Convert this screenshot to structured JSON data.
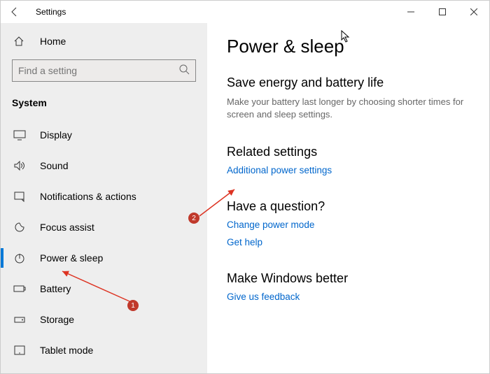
{
  "window": {
    "title": "Settings"
  },
  "sidebar": {
    "home": "Home",
    "search": {
      "placeholder": "Find a setting"
    },
    "group": "System",
    "items": [
      {
        "label": "Display"
      },
      {
        "label": "Sound"
      },
      {
        "label": "Notifications & actions"
      },
      {
        "label": "Focus assist"
      },
      {
        "label": "Power & sleep"
      },
      {
        "label": "Battery"
      },
      {
        "label": "Storage"
      },
      {
        "label": "Tablet mode"
      }
    ]
  },
  "main": {
    "title": "Power & sleep",
    "sections": [
      {
        "heading": "Save energy and battery life",
        "desc": "Make your battery last longer by choosing shorter times for screen and sleep settings."
      },
      {
        "heading": "Related settings",
        "links": [
          "Additional power settings"
        ]
      },
      {
        "heading": "Have a question?",
        "links": [
          "Change power mode",
          "Get help"
        ]
      },
      {
        "heading": "Make Windows better",
        "links": [
          "Give us feedback"
        ]
      }
    ]
  },
  "annotations": {
    "badge1": "1",
    "badge2": "2"
  }
}
